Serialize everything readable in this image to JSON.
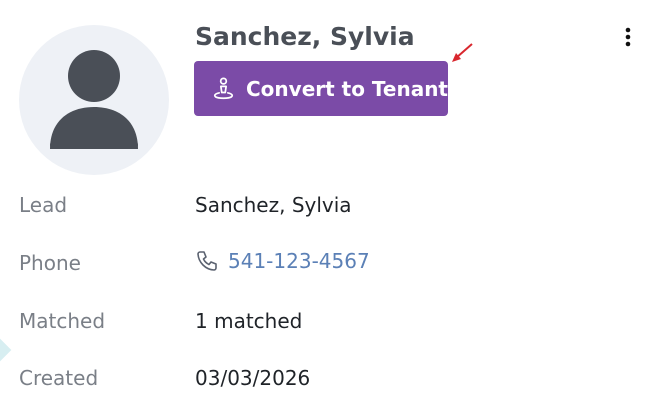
{
  "contact": {
    "name": "Sanchez, Sylvia",
    "convert_label": "Convert to Tenant"
  },
  "details": {
    "lead_label": "Lead",
    "lead_value": "Sanchez, Sylvia",
    "phone_label": "Phone",
    "phone_value": "541-123-4567",
    "matched_label": "Matched",
    "matched_value": "1 matched",
    "created_label": "Created",
    "created_value": "03/03/2026"
  },
  "icons": {
    "avatar": "user-avatar-icon",
    "convert": "tenant-person-icon",
    "menu": "kebab-menu-icon",
    "phone": "phone-icon",
    "annotation": "red-arrow-annotation"
  },
  "colors": {
    "accent": "#7b4ba7",
    "link": "#5b80b6",
    "annotation": "#d9272e"
  }
}
